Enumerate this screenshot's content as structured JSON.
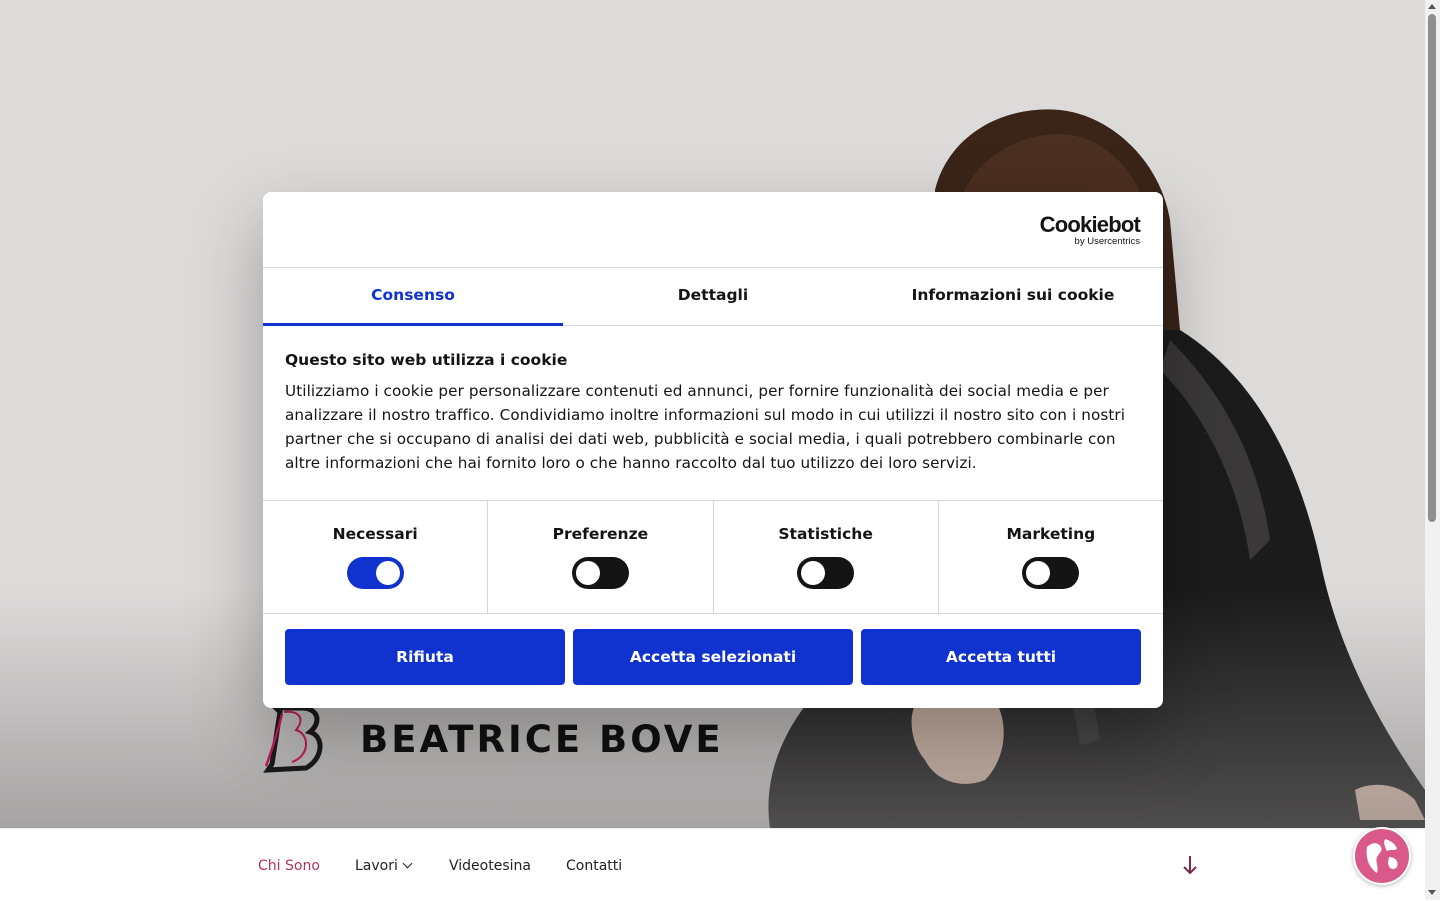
{
  "site": {
    "name": "BEATRICE BOVE",
    "logo_letter": "B"
  },
  "nav": {
    "items": [
      {
        "label": "Chi Sono",
        "active": true
      },
      {
        "label": "Lavori",
        "has_dropdown": true
      },
      {
        "label": "Videotesina"
      },
      {
        "label": "Contatti"
      }
    ],
    "scroll_icon": "arrow-down-icon",
    "language_icon": "globe-icon"
  },
  "cookie_dialog": {
    "brand": {
      "name": "Cookiebot",
      "sub": "by Usercentrics"
    },
    "tabs": [
      {
        "label": "Consenso",
        "active": true
      },
      {
        "label": "Dettagli",
        "active": false
      },
      {
        "label": "Informazioni sui cookie",
        "active": false
      }
    ],
    "title": "Questo sito web utilizza i cookie",
    "text": "Utilizziamo i cookie per personalizzare contenuti ed annunci, per fornire funzionalità dei social media e per analizzare il nostro traffico. Condividiamo inoltre informazioni sul modo in cui utilizzi il nostro sito con i nostri partner che si occupano di analisi dei dati web, pubblicità e social media, i quali potrebbero combinarle con altre informazioni che hai fornito loro o che hanno raccolto dal tuo utilizzo dei loro servizi.",
    "toggles": [
      {
        "label": "Necessari",
        "checked": true
      },
      {
        "label": "Preferenze",
        "checked": false
      },
      {
        "label": "Statistiche",
        "checked": false
      },
      {
        "label": "Marketing",
        "checked": false
      }
    ],
    "buttons": {
      "reject": "Rifiuta",
      "accept_selected": "Accetta selezionati",
      "accept_all": "Accetta tutti"
    }
  },
  "colors": {
    "accent": "#1032cf",
    "nav_active": "#b5325e",
    "hero_bg": "#dddbda",
    "globe": "#d95a8a"
  }
}
